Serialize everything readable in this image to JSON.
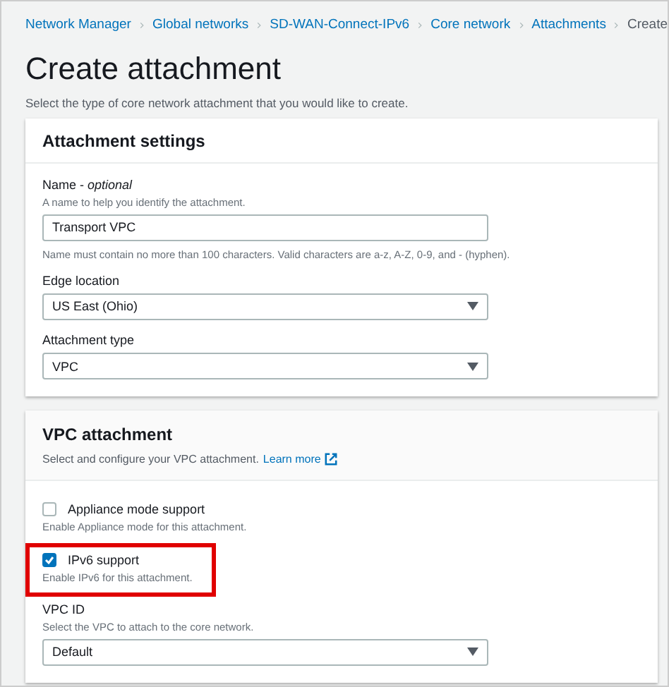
{
  "breadcrumbs": [
    {
      "label": "Network Manager",
      "link": true
    },
    {
      "label": "Global networks",
      "link": true
    },
    {
      "label": "SD-WAN-Connect-IPv6",
      "link": true
    },
    {
      "label": "Core network",
      "link": true
    },
    {
      "label": "Attachments",
      "link": true
    },
    {
      "label": "Create",
      "link": false
    }
  ],
  "page": {
    "title": "Create attachment",
    "description": "Select the type of core network attachment that you would like to create."
  },
  "attachment_settings": {
    "title": "Attachment settings",
    "fields": [
      {
        "kind": "input",
        "label": "Name - *optional*",
        "hint": "A name to help you identify the attachment.",
        "value": "Transport VPC",
        "constraint": "Name must contain no more than 100 characters. Valid characters are a-z, A-Z, 0-9, and - (hyphen)."
      },
      {
        "kind": "select",
        "label": "Edge location",
        "value": "US East (Ohio)"
      },
      {
        "kind": "select",
        "label": "Attachment type",
        "value": "VPC"
      }
    ]
  },
  "vpc_attachment": {
    "title": "VPC attachment",
    "description": "Select and configure your VPC attachment.",
    "link": "Learn more",
    "options": [
      {
        "label": "Appliance mode support",
        "hint": "Enable Appliance mode for this attachment.",
        "checked": false,
        "highlighted": false
      },
      {
        "label": "IPv6 support",
        "hint": "Enable IPv6 for this attachment.",
        "checked": true,
        "highlighted": true
      }
    ],
    "fields": [
      {
        "kind": "select",
        "label": "VPC ID",
        "hint": "Select the VPC to attach to the core network.",
        "value": "Default"
      }
    ]
  }
}
